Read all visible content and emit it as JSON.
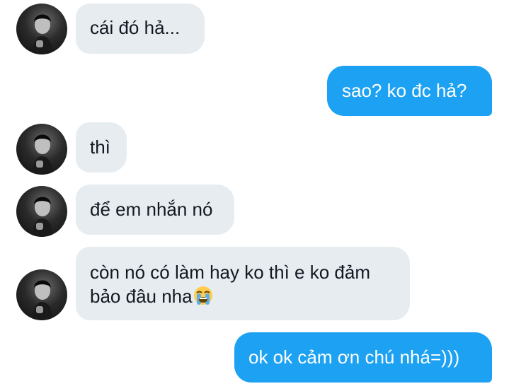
{
  "messages": [
    {
      "side": "in",
      "lines": [
        "cái đó hả..."
      ]
    },
    {
      "side": "out",
      "lines": [
        "sao? ko đc hả?"
      ]
    },
    {
      "side": "in",
      "lines": [
        "thì"
      ]
    },
    {
      "side": "in",
      "lines": [
        "để em nhắn nó"
      ]
    },
    {
      "side": "in",
      "lines": [
        "còn nó có làm hay ko thì e ko đảm",
        "bảo đâu nha"
      ],
      "emoji": "loudly-crying-face-emoji"
    },
    {
      "side": "out",
      "lines": [
        "ok ok cảm ơn chú nhá=)))"
      ]
    }
  ],
  "colors": {
    "incoming_bubble": "#e6ecf0",
    "outgoing_bubble": "#1da1f2",
    "incoming_text": "#141823",
    "outgoing_text": "#ffffff"
  },
  "icons": {
    "avatar": "user-avatar-photo"
  }
}
